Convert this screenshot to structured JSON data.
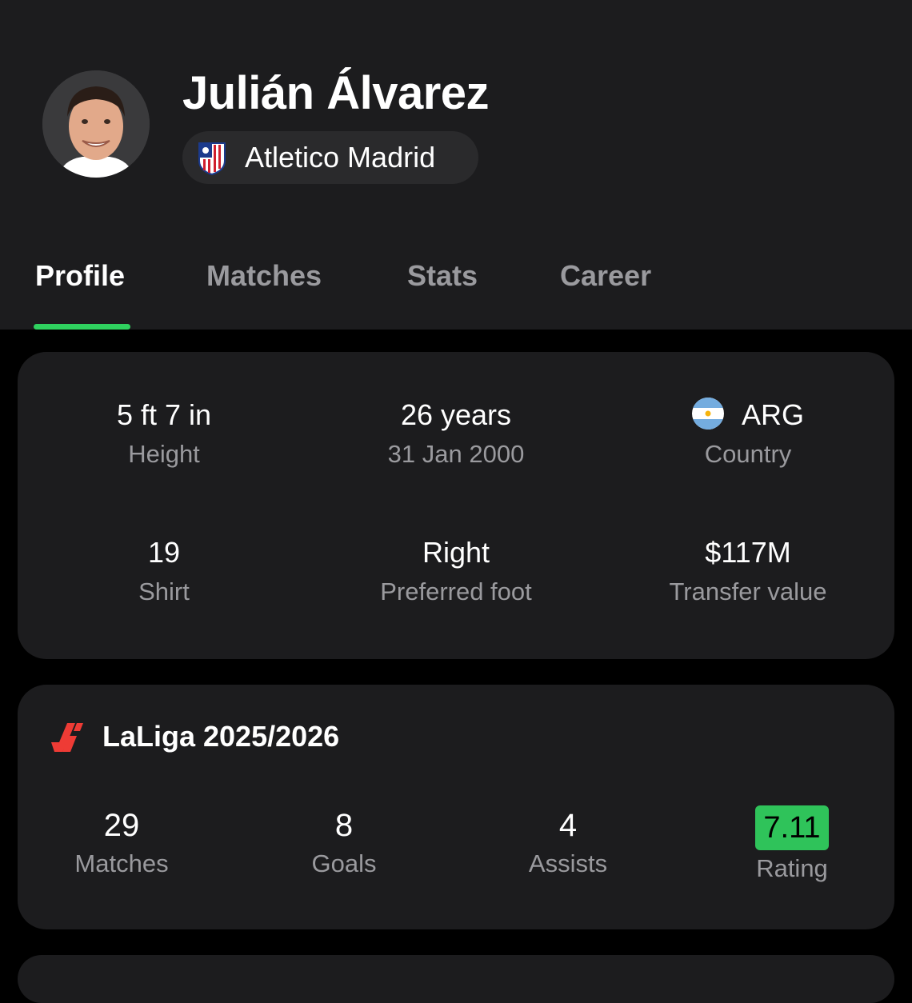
{
  "player": {
    "name": "Julián Álvarez",
    "club": "Atletico Madrid"
  },
  "tabs": [
    {
      "label": "Profile",
      "active": true
    },
    {
      "label": "Matches",
      "active": false
    },
    {
      "label": "Stats",
      "active": false
    },
    {
      "label": "Career",
      "active": false
    }
  ],
  "info": {
    "height": {
      "value": "5 ft 7 in",
      "label": "Height"
    },
    "age": {
      "value": "26 years",
      "label": "31 Jan 2000"
    },
    "country": {
      "value": "ARG",
      "label": "Country",
      "flag_icon": "argentina-flag-icon"
    },
    "shirt": {
      "value": "19",
      "label": "Shirt"
    },
    "foot": {
      "value": "Right",
      "label": "Preferred foot"
    },
    "transfer": {
      "value": "$117M",
      "label": "Transfer value"
    }
  },
  "league": {
    "title": "LaLiga 2025/2026",
    "logo_icon": "laliga-logo-icon",
    "stats": {
      "matches": {
        "value": "29",
        "label": "Matches"
      },
      "goals": {
        "value": "8",
        "label": "Goals"
      },
      "assists": {
        "value": "4",
        "label": "Assists"
      },
      "rating": {
        "value": "7.11",
        "label": "Rating"
      }
    }
  },
  "colors": {
    "accent": "#2fd15f",
    "rating_badge": "#2fc35a",
    "card_bg": "#1c1c1e",
    "page_bg": "#000000"
  }
}
